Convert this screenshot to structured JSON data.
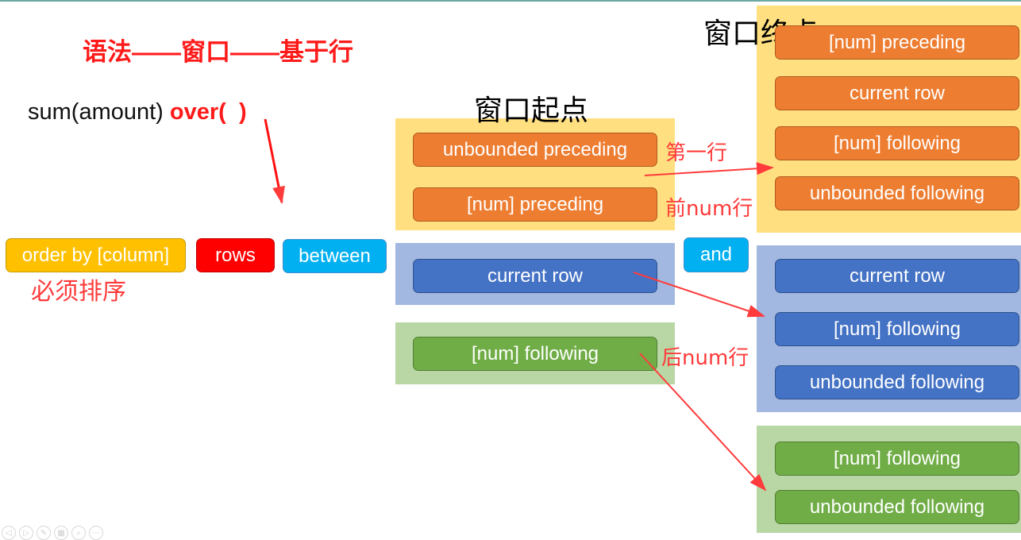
{
  "slide": {
    "title": "语法——窗口——基于行",
    "formula": {
      "prefix": "sum(amount) ",
      "keyword_open": "over(",
      "keyword_close": ")"
    },
    "colors": {
      "title_red": "#ff1a1a",
      "order_by": "#ffc000",
      "rows": "#ff0000",
      "between_and": "#00b0f0",
      "orange": "#ed7d31",
      "blue": "#4472c4",
      "green": "#70ad47",
      "panel_yellow": "#ffdf80",
      "panel_blue": "#a2b8e0",
      "panel_green": "#b9d7a5",
      "arrow": "#ff3b3b"
    },
    "clause": {
      "order_by": "order by [column]",
      "order_by_note": "必须排序",
      "rows": "rows",
      "between": "between",
      "and": "and"
    },
    "window_start": {
      "heading": "窗口起点",
      "groups": [
        {
          "color": "orange",
          "items": [
            "unbounded preceding",
            "[num] preceding"
          ]
        },
        {
          "color": "blue",
          "items": [
            "current row"
          ]
        },
        {
          "color": "green",
          "items": [
            "[num] following"
          ]
        }
      ],
      "notes": [
        "第一行",
        "前num行",
        "后num行"
      ]
    },
    "window_end": {
      "heading": "窗口终点",
      "groups": [
        {
          "color": "orange",
          "items": [
            "[num] preceding",
            "current row",
            "[num] following",
            "unbounded following"
          ]
        },
        {
          "color": "blue",
          "items": [
            "current row",
            "[num] following",
            "unbounded following"
          ]
        },
        {
          "color": "green",
          "items": [
            "[num] following",
            "unbounded following"
          ]
        }
      ]
    },
    "arrows": [
      {
        "from": "over-paren",
        "to": "clause-row"
      },
      {
        "from": "start-orange-group",
        "to": "end-orange-group"
      },
      {
        "from": "start-current-row",
        "to": "end-blue-group"
      },
      {
        "from": "start-num-following",
        "to": "end-green-group"
      }
    ]
  },
  "toolbar": {
    "buttons": [
      {
        "icon": "previous-icon",
        "glyph": "◁"
      },
      {
        "icon": "next-icon",
        "glyph": "▷"
      },
      {
        "icon": "pen-icon",
        "glyph": "✎"
      },
      {
        "icon": "slides-icon",
        "glyph": "▦"
      },
      {
        "icon": "zoom-icon",
        "glyph": "⌕"
      },
      {
        "icon": "more-icon",
        "glyph": "⋯"
      }
    ]
  }
}
